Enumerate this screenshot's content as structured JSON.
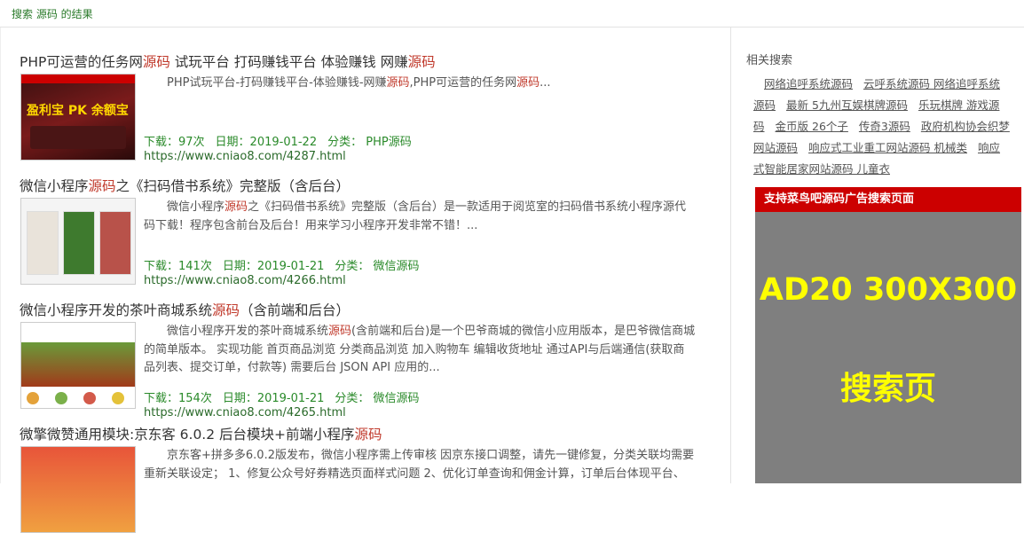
{
  "breadcrumb": "搜索 源码 的结果",
  "results": [
    {
      "title_pre": "PHP可运营的任务网",
      "title_hl": "源码",
      "title_mid": " 试玩平台 打码赚钱平台 体验赚钱 网赚",
      "title_hl2": "源码",
      "title_post": "",
      "desc_pre": "PHP试玩平台-打码赚钱平台-体验赚钱-网赚",
      "desc_hl": "源码",
      "desc_mid": ",PHP可运营的任务网",
      "desc_hl2": "源码",
      "desc_post": "...",
      "downloads": "下载：97次",
      "date": "日期：2019-01-22",
      "category": "分类： PHP源码",
      "url": "https://www.cniao8.com/4287.html",
      "thumb_text": "盈利宝 PK 余额宝"
    },
    {
      "title_pre": "微信小程序",
      "title_hl": "源码",
      "title_mid": "之《扫码借书系统》完整版（含后台）",
      "title_hl2": "",
      "title_post": "",
      "desc_pre": "微信小程序",
      "desc_hl": "源码",
      "desc_mid": "之《扫码借书系统》完整版（含后台）是一款适用于阅览室的扫码借书系统小程序源代码下载！程序包含前台及后台！用来学习小程序开发非常不错！...",
      "desc_hl2": "",
      "desc_post": "",
      "downloads": "下载：141次",
      "date": "日期：2019-01-21",
      "category": "分类： 微信源码",
      "url": "https://www.cniao8.com/4266.html",
      "thumb_text": ""
    },
    {
      "title_pre": "微信小程序开发的茶叶商城系统",
      "title_hl": "源码",
      "title_mid": "（含前端和后台）",
      "title_hl2": "",
      "title_post": "",
      "desc_pre": "微信小程序开发的茶叶商城系统",
      "desc_hl": "源码",
      "desc_mid": "(含前端和后台)是一个巴爷商城的微信小应用版本，是巴爷微信商城的简单版本。 实现功能 首页商品浏览 分类商品浏览 加入购物车 编辑收货地址 通过API与后端通信(获取商品列表、提交订单，付款等) 需要后台 JSON API 应用的...",
      "desc_hl2": "",
      "desc_post": "",
      "downloads": "下载：154次",
      "date": "日期：2019-01-21",
      "category": "分类： 微信源码",
      "url": "https://www.cniao8.com/4265.html",
      "thumb_text": ""
    },
    {
      "title_pre": "微擎微赞通用模块:京东客 6.0.2 后台模块+前端小程序",
      "title_hl": "源码",
      "title_mid": "",
      "title_hl2": "",
      "title_post": "",
      "desc_pre": "京东客+拼多多6.0.2版发布，微信小程序需上传审核 因京东接口调整，请先一键修复，分类关联均需要重新关联设定； 1、修复公众号好券精选页面样式问题 2、优化订单查询和佣金计算，订单后台体现平台、",
      "desc_hl": "",
      "desc_mid": "",
      "desc_hl2": "",
      "desc_post": "",
      "downloads": "",
      "date": "",
      "category": "",
      "url": "",
      "thumb_text": ""
    }
  ],
  "sidebar": {
    "title": "相关搜索",
    "tags": [
      "网络追呼系统源码",
      "云呼系统源码 网络追呼系统源码",
      "最新 5九州互娱棋牌源码",
      "乐玩棋牌 游戏源码",
      "金币版 26个子",
      "传奇3源码",
      "政府机构协会织梦网站源码",
      "响应式工业重工网站源码 机械类",
      "响应式智能居家网站源码 儿童衣"
    ],
    "ad_header": "支持菜鸟吧源码广告搜索页面",
    "ad_line1": "AD20 300X300",
    "ad_line2": "搜索页"
  },
  "colors": {
    "highlight": "#c0392b",
    "meta_green": "#2a8a2a",
    "ad_red": "#cc0000",
    "ad_gray": "#7f7f7f",
    "ad_text": "#ffff00"
  }
}
